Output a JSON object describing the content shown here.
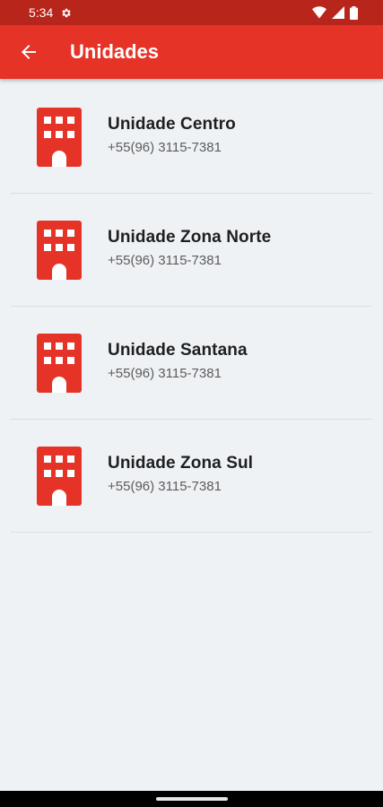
{
  "status_bar": {
    "time": "5:34"
  },
  "app_bar": {
    "title": "Unidades"
  },
  "colors": {
    "primary": "#e53427",
    "status_bar": "#b8251b",
    "background": "#eff2f5"
  },
  "units": [
    {
      "name": "Unidade Centro",
      "phone": "+55(96) 3115-7381",
      "icon": "building-icon"
    },
    {
      "name": "Unidade Zona Norte",
      "phone": "+55(96) 3115-7381",
      "icon": "building-icon"
    },
    {
      "name": "Unidade Santana",
      "phone": "+55(96) 3115-7381",
      "icon": "building-icon"
    },
    {
      "name": "Unidade Zona Sul",
      "phone": "+55(96) 3115-7381",
      "icon": "building-icon"
    }
  ]
}
